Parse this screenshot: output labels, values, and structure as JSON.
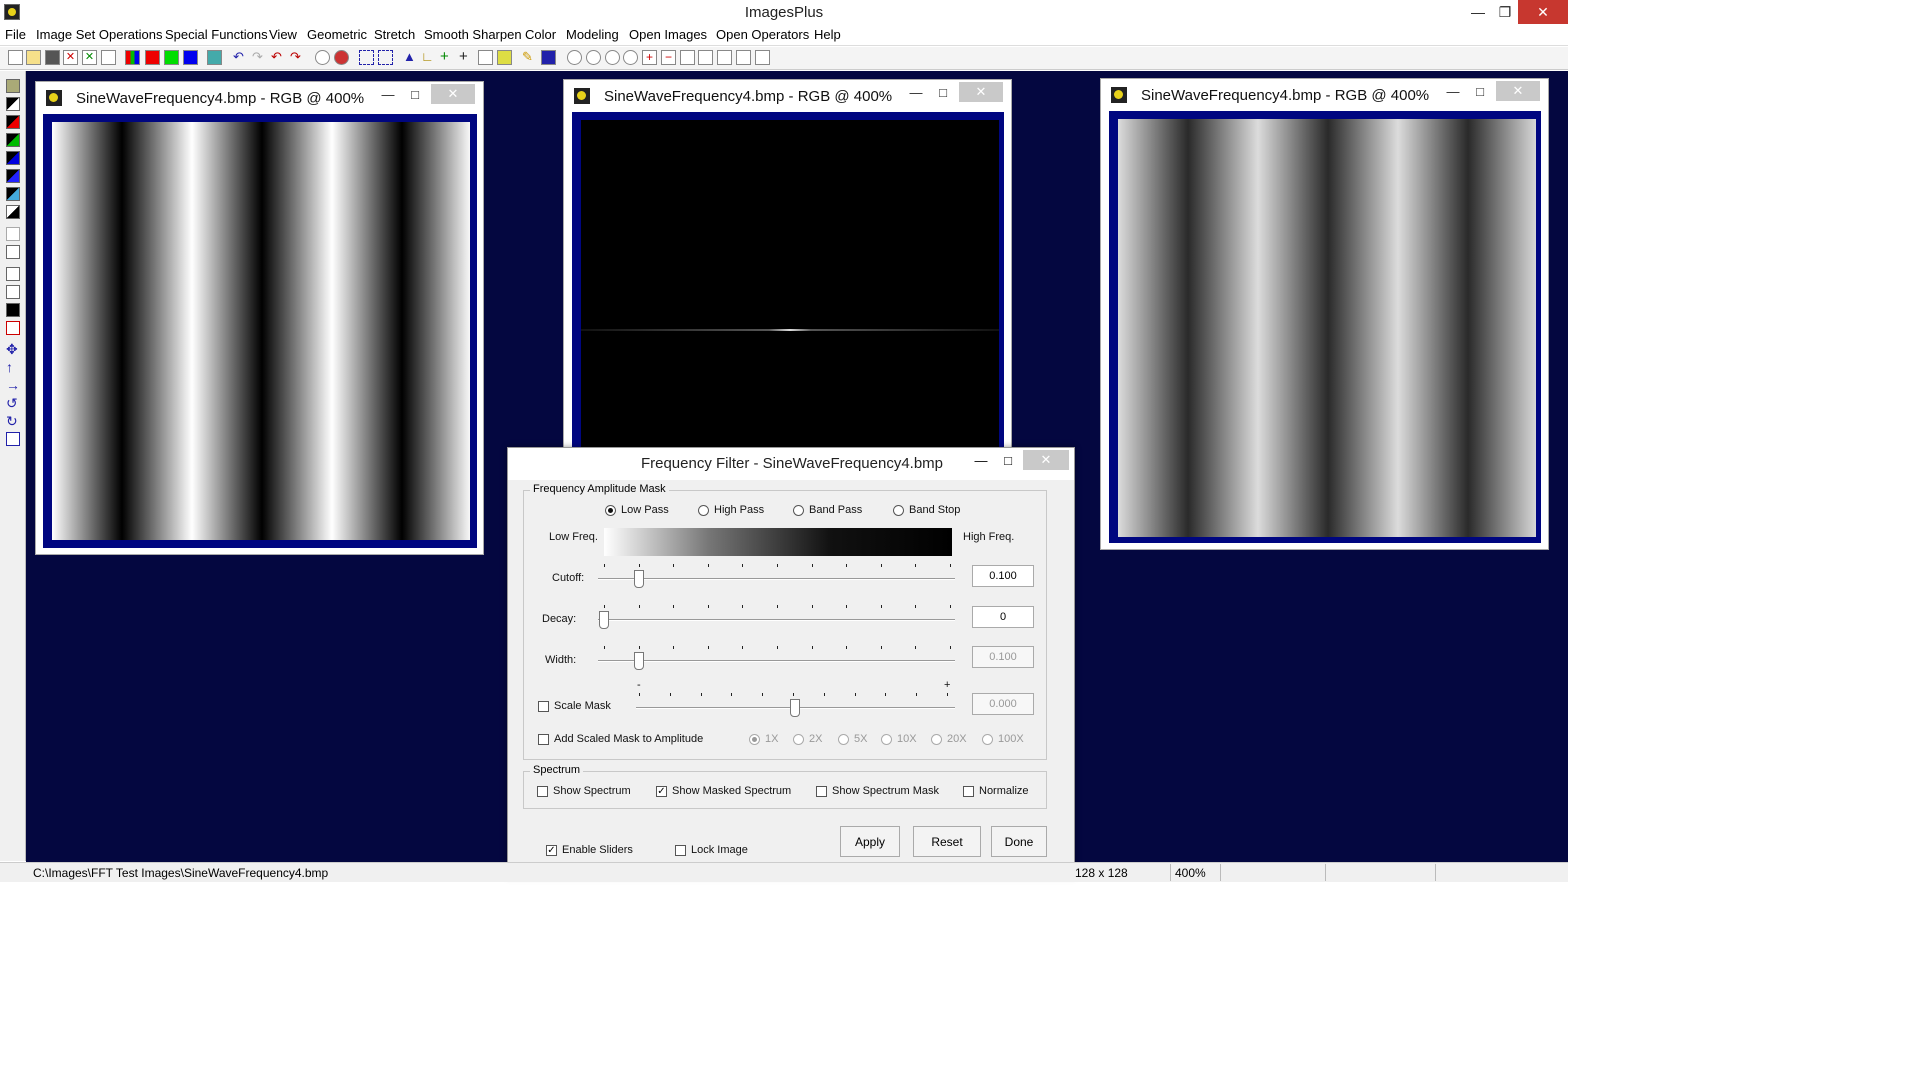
{
  "app": {
    "title": "ImagesPlus"
  },
  "menu": [
    "File",
    "Image Set Operations",
    "Special Functions",
    "View",
    "Geometric",
    "Stretch",
    "Smooth Sharpen",
    "Color",
    "Modeling",
    "Open Images",
    "Open Operators",
    "Help"
  ],
  "windows": [
    {
      "title": "SineWaveFrequency4.bmp - RGB @ 400%"
    },
    {
      "title": "SineWaveFrequency4.bmp - RGB @ 400%"
    },
    {
      "title": "SineWaveFrequency4.bmp - RGB @ 400%"
    }
  ],
  "dialog": {
    "title": "Frequency Filter - SineWaveFrequency4.bmp",
    "mask_group": "Frequency Amplitude Mask",
    "filter_types": [
      "Low Pass",
      "High Pass",
      "Band Pass",
      "Band Stop"
    ],
    "selected_filter": "Low Pass",
    "low_freq": "Low Freq.",
    "high_freq": "High Freq.",
    "cutoff_label": "Cutoff:",
    "cutoff_value": "0.100",
    "decay_label": "Decay:",
    "decay_value": "0",
    "width_label": "Width:",
    "width_value": "0.100",
    "scale_mask_label": "Scale Mask",
    "scale_value": "0.000",
    "scale_minus": "-",
    "scale_plus": "+",
    "add_scaled_label": "Add Scaled Mask to Amplitude",
    "multipliers": [
      "1X",
      "2X",
      "5X",
      "10X",
      "20X",
      "100X"
    ],
    "spectrum_group": "Spectrum",
    "show_spectrum": "Show Spectrum",
    "show_masked_spectrum": "Show Masked Spectrum",
    "show_spectrum_mask": "Show Spectrum Mask",
    "normalize": "Normalize",
    "enable_sliders": "Enable Sliders",
    "lock_image": "Lock Image",
    "apply": "Apply",
    "reset": "Reset",
    "done": "Done",
    "checkmark": "✓"
  },
  "status": {
    "path": "C:\\Images\\FFT Test Images\\SineWaveFrequency4.bmp",
    "size": "128 x 128",
    "zoom": "400%"
  },
  "colors": {
    "workspace": "#040740",
    "image_frame": "#000680",
    "close": "#c7372f"
  }
}
